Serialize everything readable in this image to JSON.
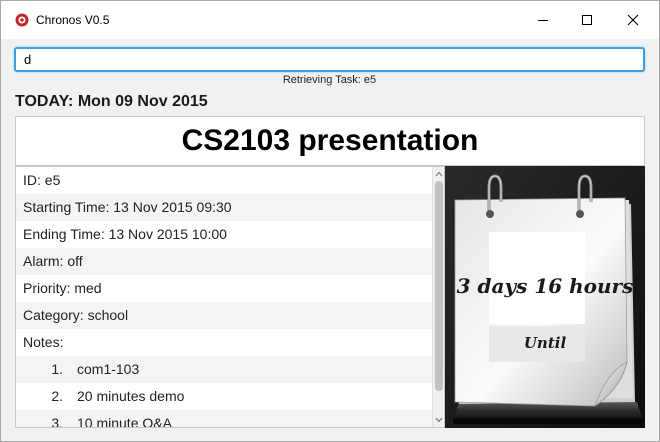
{
  "window": {
    "title": "Chronos V0.5"
  },
  "command": {
    "value": "d"
  },
  "status": "Retrieving Task: e5",
  "today_label": "TODAY: Mon 09 Nov 2015",
  "task": {
    "title": "CS2103 presentation",
    "id": "ID: e5",
    "start": "Starting Time: 13 Nov 2015 09:30",
    "end": "Ending Time: 13 Nov 2015 10:00",
    "alarm": "Alarm: off",
    "priority": "Priority:  med",
    "category": "Category:  school",
    "notes_label": "Notes:",
    "notes": [
      {
        "num": "1.",
        "text": "com1-103"
      },
      {
        "num": "2.",
        "text": "20 minutes demo"
      },
      {
        "num": "3.",
        "text": "10 minute Q&A"
      }
    ]
  },
  "calendar": {
    "countdown": "3 days 16 hours",
    "until": "Until"
  },
  "colors": {
    "input_border": "#3d9fe0",
    "app_icon": "#c0282d"
  }
}
